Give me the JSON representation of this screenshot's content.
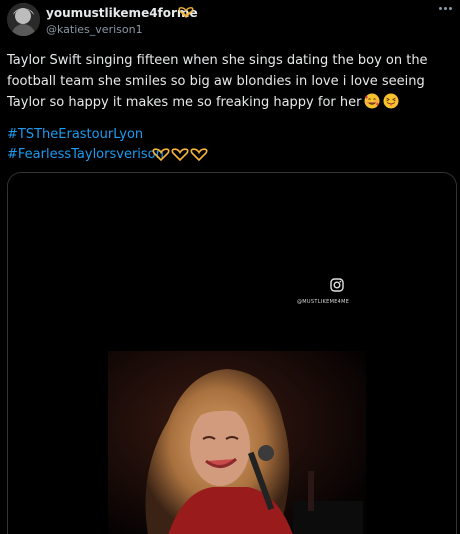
{
  "author": {
    "display_name": "youmustlikeme4forme",
    "handle": "@katies_verison1",
    "badge_icon": "heart-hands-icon"
  },
  "more_icon": "more-options-icon",
  "tweet": {
    "text": "Taylor Swift singing fifteen when she sings dating the boy on the football team she smiles so big aw blondies in love i love seeing Taylor so happy it makes me so freaking happy for her",
    "emojis": [
      "smiling-face-with-hearts-emoji",
      "squinting-face-with-tongue-emoji"
    ],
    "hashtags": [
      "#TSTheErastourLyon",
      "#FearlessTaylorsverison"
    ],
    "hashtag_emojis": [
      "heart-hands-icon",
      "heart-hands-icon",
      "heart-hands-icon"
    ]
  },
  "media": {
    "watermark": "@MUSTLIKEME4ME",
    "watermark_icon": "instagram-icon"
  },
  "colors": {
    "background": "#000000",
    "text": "#e7e9ea",
    "muted": "#8b98a5",
    "link": "#1d9bf0",
    "badge": "#f4b63a"
  }
}
